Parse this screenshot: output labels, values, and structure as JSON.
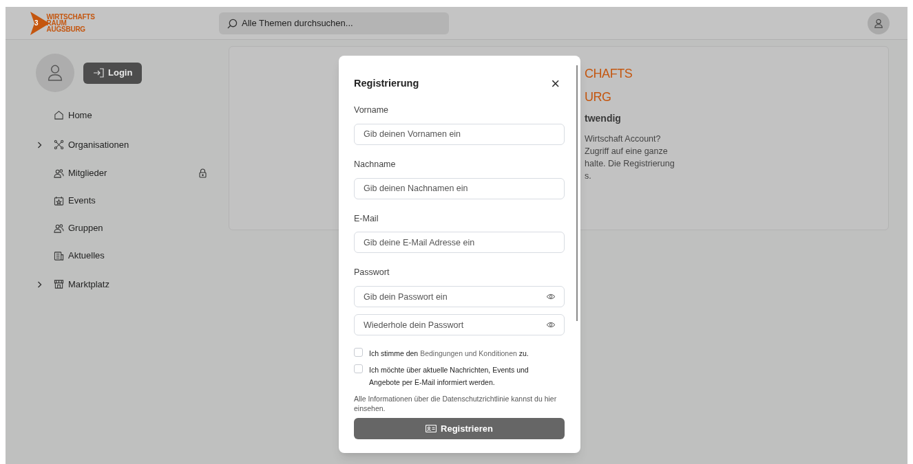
{
  "header": {
    "logo": [
      "WIRTSCHAFTS",
      "RAUM",
      "AUGSBURG"
    ],
    "logo_mark": "3",
    "search": {
      "placeholder": "Alle Themen durchsuchen..."
    }
  },
  "sidebar": {
    "login_button": "Login",
    "items": [
      {
        "label": "Home",
        "expandable": false,
        "locked": false
      },
      {
        "label": "Organisationen",
        "expandable": true,
        "locked": false
      },
      {
        "label": "Mitglieder",
        "expandable": false,
        "locked": true
      },
      {
        "label": "Events",
        "expandable": false,
        "locked": false
      },
      {
        "label": "Gruppen",
        "expandable": false,
        "locked": false
      },
      {
        "label": "Aktuelles",
        "expandable": false,
        "locked": false
      },
      {
        "label": "Marktplatz",
        "expandable": true,
        "locked": false
      }
    ]
  },
  "background_card": {
    "logo_lines": [
      "CHAFTS",
      "URG"
    ],
    "heading": "twendig",
    "text_lines": [
      "Wirtschaft Account?",
      "Zugriff auf eine ganze",
      "halte. Die Registrierung",
      "s."
    ]
  },
  "dialog": {
    "title": "Registrierung",
    "close": "×",
    "sections": [
      {
        "label": "Vorname",
        "fields": [
          {
            "kind": "text",
            "placeholder": "Gib deinen Vornamen ein"
          }
        ]
      },
      {
        "label": "Nachname",
        "fields": [
          {
            "kind": "text",
            "placeholder": "Gib deinen Nachnamen ein"
          }
        ]
      },
      {
        "label": "E-Mail",
        "fields": [
          {
            "kind": "text",
            "placeholder": "Gib deine E-Mail Adresse ein"
          }
        ]
      },
      {
        "label": "Passwort",
        "fields": [
          {
            "kind": "password",
            "placeholder": "Gib dein Passwort ein"
          },
          {
            "kind": "password",
            "placeholder": "Wiederhole dein Passwort"
          }
        ]
      }
    ],
    "checkboxes": [
      {
        "checked": false,
        "text": "Ich stimme den ",
        "link": "Bedingungen und Konditionen",
        "text_after": " zu."
      },
      {
        "checked": false,
        "text": "Ich möchte über aktuelle Nachrichten, Events und Angebote per E-Mail informiert werden."
      }
    ],
    "privacy_note": "Alle Informationen über die Datenschutzrichtlinie kannst du hier einsehen.",
    "submit_button": "Registrieren"
  }
}
